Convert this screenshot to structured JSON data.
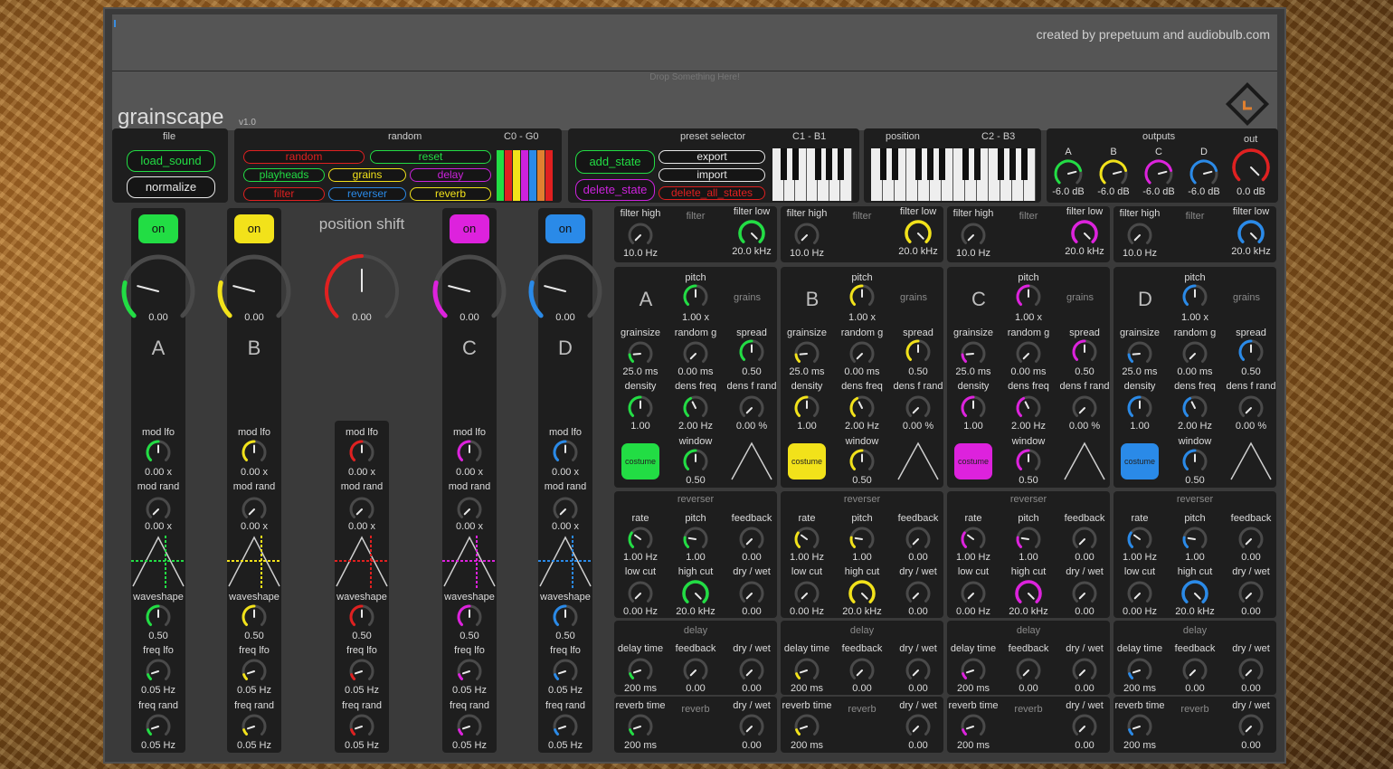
{
  "header": {
    "credit": "created by prepetuum and audiobulb.com",
    "drop": "Drop Something Here!",
    "title": "grainscape",
    "version": "v1.0"
  },
  "file": {
    "title": "file",
    "load": "load_sound",
    "normalize": "normalize"
  },
  "random": {
    "title": "random",
    "range": "C0 - G0",
    "buttons": [
      {
        "label": "random",
        "color": "#e02020"
      },
      {
        "label": "reset",
        "color": "#22dd44"
      },
      {
        "label": "playheads",
        "color": "#22dd44"
      },
      {
        "label": "grains",
        "color": "#f2e21a"
      },
      {
        "label": "delay",
        "color": "#cc22dd"
      },
      {
        "label": "filter",
        "color": "#e02020"
      },
      {
        "label": "reverser",
        "color": "#2a8ae8"
      },
      {
        "label": "reverb",
        "color": "#f2e21a"
      }
    ]
  },
  "preset": {
    "title": "preset selector",
    "range": "C1 - B1",
    "add": "add_state",
    "export": "export",
    "import": "import",
    "delete": "delete_state",
    "delete_all": "delete_all_states"
  },
  "position": {
    "title": "position",
    "range": "C2 - B3"
  },
  "outputs": {
    "title": "outputs",
    "out_label": "out",
    "out_value": "0.0 dB",
    "channels": [
      {
        "name": "A",
        "value": "-6.0 dB"
      },
      {
        "name": "B",
        "value": "-6.0 dB"
      },
      {
        "name": "C",
        "value": "-6.0 dB"
      },
      {
        "name": "D",
        "value": "-6.0 dB"
      }
    ]
  },
  "position_shift": {
    "label": "position shift",
    "value": "0.00"
  },
  "colors": {
    "A": "#22dd44",
    "B": "#f2e21a",
    "C": "#dd22dd",
    "D": "#2a8ae8",
    "shift": "#e02020"
  },
  "strip_labels": {
    "on": "on",
    "mod_lfo": "mod lfo",
    "mod_rand": "mod rand",
    "waveshape": "waveshape",
    "freq_lfo": "freq lfo",
    "freq_rand": "freq rand"
  },
  "strips": [
    {
      "name": "A",
      "value": "0.00",
      "mod_lfo": "0.00 x",
      "mod_rand": "0.00 x",
      "waveshape": "0.50",
      "freq_lfo": "0.05 Hz",
      "freq_rand": "0.05 Hz"
    },
    {
      "name": "B",
      "value": "0.00",
      "mod_lfo": "0.00 x",
      "mod_rand": "0.00 x",
      "waveshape": "0.50",
      "freq_lfo": "0.05 Hz",
      "freq_rand": "0.05 Hz"
    },
    {
      "name": "",
      "value": "0.00",
      "mod_lfo": "0.00 x",
      "mod_rand": "0.00 x",
      "waveshape": "0.50",
      "freq_lfo": "0.05 Hz",
      "freq_rand": "0.05 Hz"
    },
    {
      "name": "C",
      "value": "0.00",
      "mod_lfo": "0.00 x",
      "mod_rand": "0.00 x",
      "waveshape": "0.50",
      "freq_lfo": "0.05 Hz",
      "freq_rand": "0.05 Hz"
    },
    {
      "name": "D",
      "value": "0.00",
      "mod_lfo": "0.00 x",
      "mod_rand": "0.00 x",
      "waveshape": "0.50",
      "freq_lfo": "0.05 Hz",
      "freq_rand": "0.05 Hz"
    }
  ],
  "voice_labels": {
    "filter_high": "filter high",
    "filter": "filter",
    "filter_low": "filter low",
    "pitch": "pitch",
    "grains": "grains",
    "grainsize": "grainsize",
    "random_g": "random g",
    "spread": "spread",
    "density": "density",
    "dens_freq": "dens freq",
    "dens_f_rand": "dens f rand",
    "window": "window",
    "costume": "costume",
    "reverser": "reverser",
    "rate": "rate",
    "feedback": "feedback",
    "low_cut": "low cut",
    "high_cut": "high cut",
    "dry_wet": "dry / wet",
    "delay": "delay",
    "delay_time": "delay time",
    "reverb_time": "reverb time",
    "reverb": "reverb"
  },
  "voice": {
    "filter_high": "10.0 Hz",
    "filter_low": "20.0 kHz",
    "pitch": "1.00 x",
    "grainsize": "25.0 ms",
    "random_g": "0.00 ms",
    "spread": "0.50",
    "density": "1.00",
    "dens_freq": "2.00 Hz",
    "dens_f_rand": "0.00 %",
    "window": "0.50",
    "rev_rate": "1.00 Hz",
    "rev_pitch": "1.00",
    "rev_feedback": "0.00",
    "low_cut": "0.00 Hz",
    "high_cut": "20.0 kHz",
    "rev_drywet": "0.00",
    "delay_time": "200 ms",
    "delay_feedback": "0.00",
    "delay_drywet": "0.00",
    "reverb_time": "200 ms",
    "reverb_drywet": "0.00"
  },
  "voices": [
    {
      "name": "A"
    },
    {
      "name": "B"
    },
    {
      "name": "C"
    },
    {
      "name": "D"
    }
  ]
}
